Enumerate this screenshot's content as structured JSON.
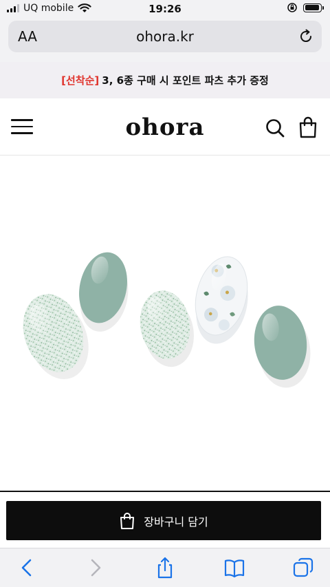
{
  "status_bar": {
    "carrier": "UQ mobile",
    "time": "19:26",
    "battery_level": 0.95
  },
  "browser": {
    "text_size_label": "AA",
    "url": "ohora.kr",
    "icons": [
      "reload-icon",
      "back-icon",
      "forward-icon",
      "share-icon",
      "bookmarks-icon",
      "tabs-icon"
    ]
  },
  "promo_banner": {
    "tag": "[선착순]",
    "message": "3, 6종 구매 시 포인트 파츠 추가 증정"
  },
  "header": {
    "logo": "ohora",
    "icons": [
      "menu-icon",
      "search-icon",
      "shopping-bag-icon"
    ]
  },
  "product": {
    "nail_colors": {
      "sage": "#8fb2a6",
      "glitter": "#d9e8df",
      "clear": "#f4f6f8"
    }
  },
  "cart_button": {
    "label": "장바구니 담기"
  },
  "colors": {
    "promo_tag": "#e0342d",
    "accent_dark": "#0d0d0d",
    "browser_link": "#1a73e8"
  }
}
